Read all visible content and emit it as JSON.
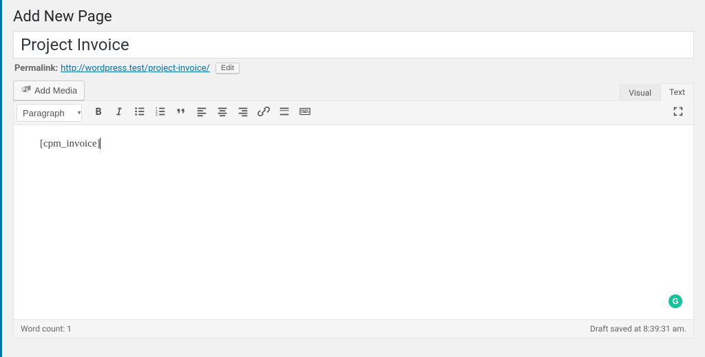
{
  "header": {
    "page_title": "Add New Page"
  },
  "title_field": {
    "value": "Project Invoice"
  },
  "permalink": {
    "label": "Permalink:",
    "url_text": "http://wordpress.test/project-invoice/",
    "edit_button": "Edit"
  },
  "media": {
    "add_media_label": "Add Media"
  },
  "tabs": {
    "visual": "Visual",
    "text": "Text"
  },
  "toolbar": {
    "format_selected": "Paragraph"
  },
  "content": {
    "body_text": "[cpm_invoice]"
  },
  "statusbar": {
    "word_count_label": "Word count: 1",
    "save_status": "Draft saved at 8:39:31 am."
  }
}
